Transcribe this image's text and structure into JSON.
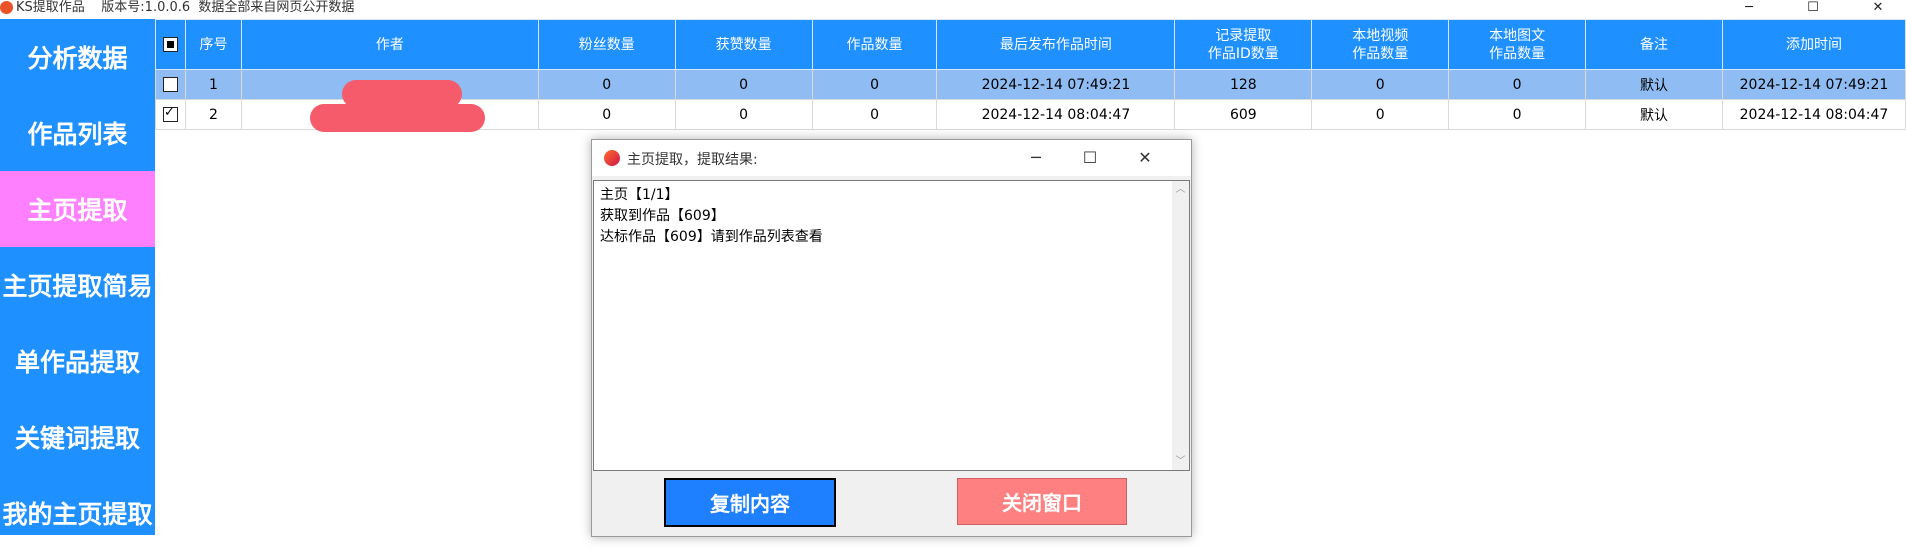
{
  "window": {
    "title": "KS提取作品    版本号:1.0.0.6  数据全部来自网页公开数据",
    "min_icon": "minimize-icon",
    "max_icon": "maximize-icon",
    "close_icon": "close-icon"
  },
  "sidebar": {
    "items": [
      {
        "label": "分析数据"
      },
      {
        "label": "作品列表"
      },
      {
        "label": "主页提取",
        "active": true
      },
      {
        "label": "主页提取简易"
      },
      {
        "label": "单作品提取"
      },
      {
        "label": "关键词提取"
      },
      {
        "label": "我的主页提取"
      }
    ],
    "color": "#1e90ff",
    "active_color": "#ff80ff"
  },
  "table": {
    "headers": [
      "序号",
      "作者",
      "粉丝数量",
      "获赞数量",
      "作品数量",
      "最后发布作品时间",
      "记录提取\n作品ID数量",
      "本地视频\n作品数量",
      "本地图文\n作品数量",
      "备注",
      "添加时间"
    ],
    "rows": [
      {
        "checked": false,
        "selected": true,
        "cells": [
          "1",
          "",
          "0",
          "0",
          "0",
          "2024-12-14 07:49:21",
          "128",
          "0",
          "0",
          "默认",
          "2024-12-14 07:49:21"
        ]
      },
      {
        "checked": true,
        "selected": false,
        "cells": [
          "2",
          "",
          "0",
          "0",
          "0",
          "2024-12-14 08:04:47",
          "609",
          "0",
          "0",
          "默认",
          "2024-12-14 08:04:47"
        ]
      }
    ]
  },
  "dialog": {
    "title": "主页提取，提取结果:",
    "lines": [
      "主页【1/1】",
      "获取到作品【609】",
      "达标作品【609】请到作品列表查看"
    ],
    "copy_button": "复制内容",
    "close_button": "关闭窗口"
  }
}
